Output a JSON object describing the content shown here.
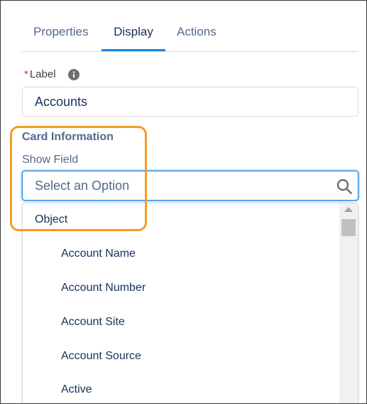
{
  "tabs": [
    {
      "label": "Properties",
      "active": false
    },
    {
      "label": "Display",
      "active": true
    },
    {
      "label": "Actions",
      "active": false
    }
  ],
  "label_field": {
    "required_marker": "*",
    "label": "Label",
    "icon": "info-icon",
    "value": "Accounts"
  },
  "card_information": {
    "title": "Card Information",
    "show_field_label": "Show Field",
    "combobox_placeholder": "Select an Option",
    "icon": "search-icon"
  },
  "dropdown": {
    "group_label": "Object",
    "options": [
      "Account Name",
      "Account Number",
      "Account Site",
      "Account Source",
      "Active"
    ]
  },
  "colors": {
    "accent": "#1589ee",
    "highlight": "#f59a23",
    "required": "#c23934",
    "text_dark": "#16325c"
  }
}
